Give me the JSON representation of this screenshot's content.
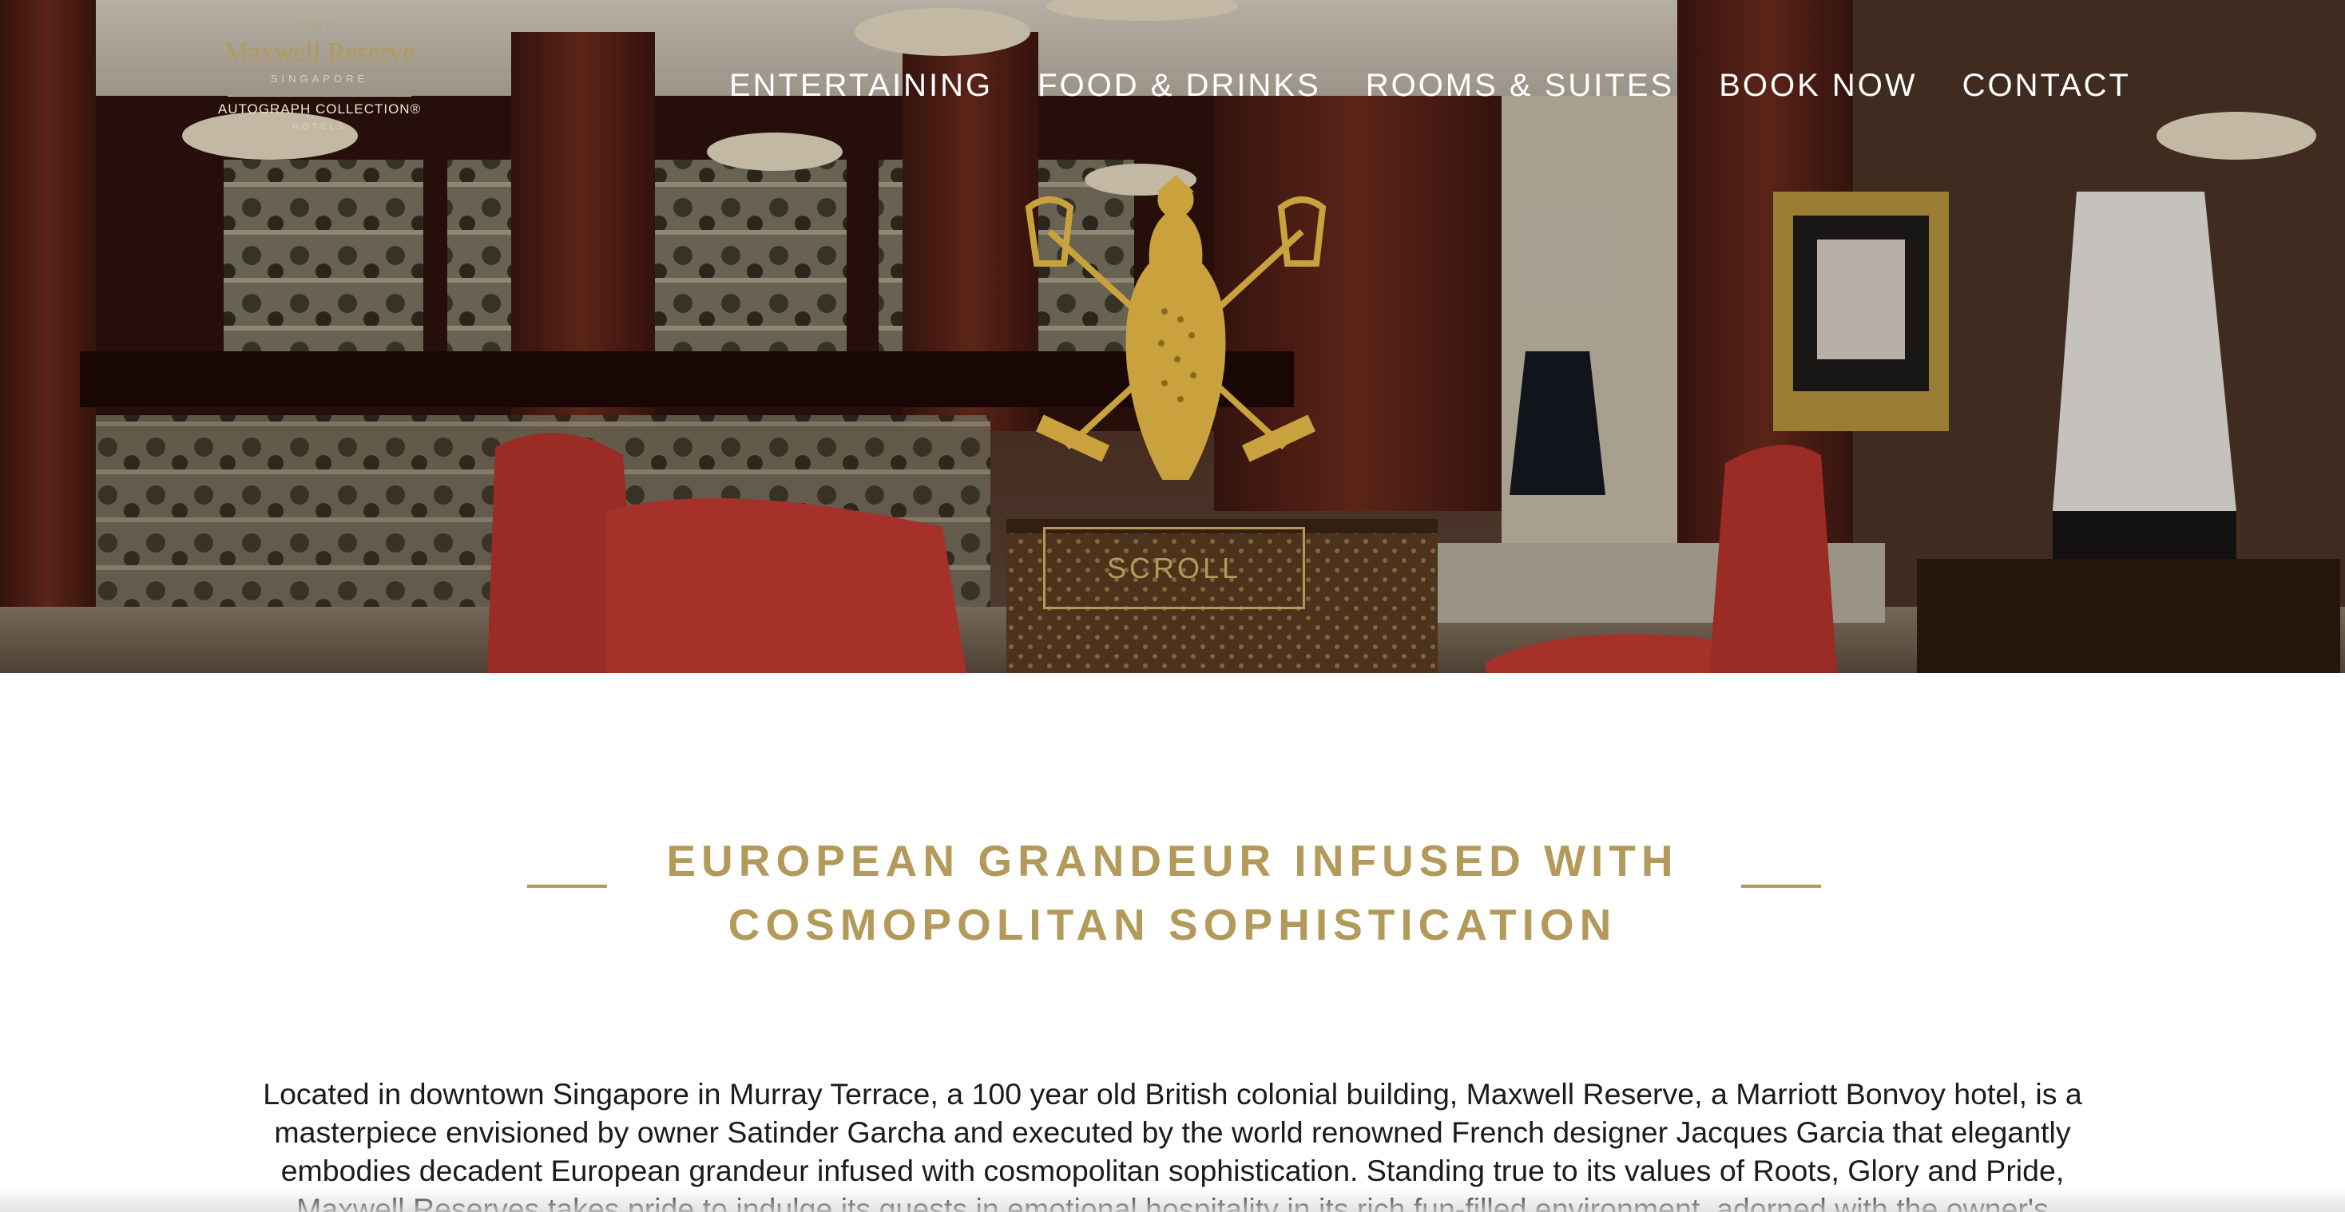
{
  "colors": {
    "gold": "#b39a5a",
    "nav_text": "#ffffff",
    "body_text": "#1b1b1b",
    "background": "#ffffff"
  },
  "logo": {
    "the": "THE",
    "name": "Maxwell Reserve",
    "city": "SINGAPORE",
    "collection": "AUTOGRAPH COLLECTION®",
    "hotels": "HOTELS"
  },
  "nav": {
    "items": [
      {
        "label": "ENTERTAINING"
      },
      {
        "label": "FOOD & DRINKS"
      },
      {
        "label": "ROOMS & SUITES"
      },
      {
        "label": "BOOK NOW"
      },
      {
        "label": "CONTACT"
      }
    ]
  },
  "hero": {
    "crest_icon": "falcon-crest-icon",
    "scroll_label": "SCROLL"
  },
  "section": {
    "heading_line1": "EUROPEAN GRANDEUR INFUSED WITH",
    "heading_line2": "COSMOPOLITAN SOPHISTICATION",
    "intro": "Located in downtown Singapore in Murray Terrace, a 100 year old British colonial building, Maxwell Reserve, a Marriott Bonvoy hotel, is a masterpiece envisioned by owner Satinder Garcha and executed by the world renowned French designer Jacques Garcia that elegantly embodies decadent European grandeur infused with cosmopolitan sophistication. Standing true to its values of Roots, Glory and Pride, Maxwell Reserves takes pride to indulge its guests in emotional hospitality in its rich fun-filled environment, adorned with the owner's museum quality family"
  }
}
